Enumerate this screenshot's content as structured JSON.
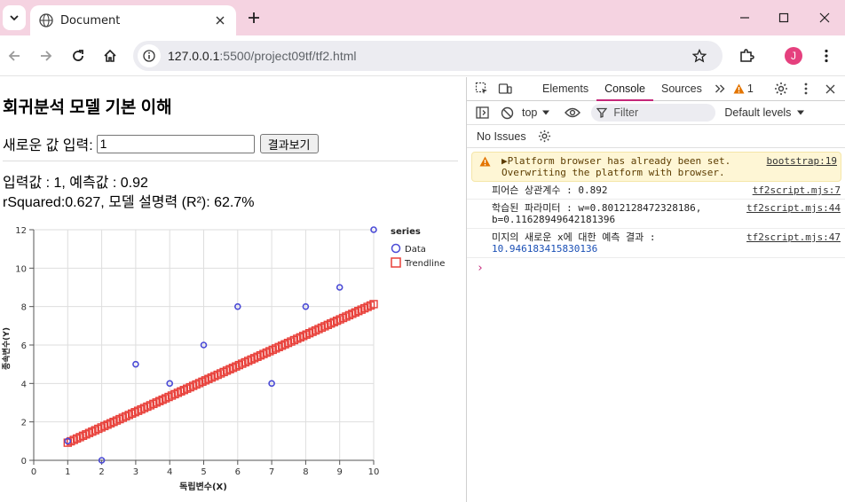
{
  "browser": {
    "tab_title": "Document",
    "url_host": "127.0.0.1",
    "url_rest": ":5500/project09tf/tf2.html",
    "avatar_letter": "J",
    "accent": "#f5d3e1"
  },
  "page": {
    "heading": "회귀분석 모델 기본 이해",
    "input_label": "새로운 값 입력:",
    "input_value": "1",
    "button_label": "결과보기",
    "result_line1": "입력값 : 1, 예측값 : 0.92",
    "result_line2": "rSquared:0.627, 모델 설명력 (R²): 62.7%"
  },
  "chart_data": {
    "type": "scatter",
    "xlabel": "독립변수(X)",
    "ylabel": "종속변수(Y)",
    "xlim": [
      0,
      10
    ],
    "ylim": [
      0,
      12
    ],
    "x_ticks": [
      "0",
      "1",
      "2",
      "3",
      "4",
      "5",
      "6",
      "7",
      "8",
      "9",
      "10"
    ],
    "y_ticks": [
      "0",
      "2",
      "4",
      "6",
      "8",
      "10",
      "12"
    ],
    "legend_title": "series",
    "legend_position": "top-right",
    "grid": true,
    "series": [
      {
        "name": "Data",
        "color": "#4b4bd6",
        "marker": "circle",
        "x": [
          1,
          2,
          3,
          4,
          5,
          6,
          7,
          8,
          9,
          10
        ],
        "y": [
          1,
          0,
          5,
          4,
          6,
          8,
          4,
          8,
          9,
          12
        ]
      },
      {
        "name": "Trendline",
        "color": "#e8403a",
        "marker": "square",
        "x_range": [
          1,
          10
        ],
        "slope": 0.8012128472328186,
        "intercept": 0.11628949642181396
      }
    ]
  },
  "devtools": {
    "tabs": [
      "Elements",
      "Console",
      "Sources"
    ],
    "active_tab": "Console",
    "issue_count": "1",
    "context": "top",
    "filter_placeholder": "Filter",
    "levels": "Default levels",
    "no_issues": "No Issues",
    "messages": [
      {
        "type": "warning",
        "text": "▶Platform browser has already been set. Overwriting the platform with browser.",
        "source": "bootstrap:19"
      },
      {
        "type": "log",
        "text": "피어슨 상관계수 : 0.892",
        "source": "tf2script.mjs:7"
      },
      {
        "type": "log",
        "text": "학습된 파라미터 : w=0.8012128472328186, b=0.11628949642181396",
        "source": "tf2script.mjs:44"
      },
      {
        "type": "log",
        "text": "미지의 새로운 x에 대한 예측 결과 :",
        "value": "10.946183415830136",
        "source": "tf2script.mjs:47"
      }
    ],
    "prompt_symbol": "›"
  }
}
